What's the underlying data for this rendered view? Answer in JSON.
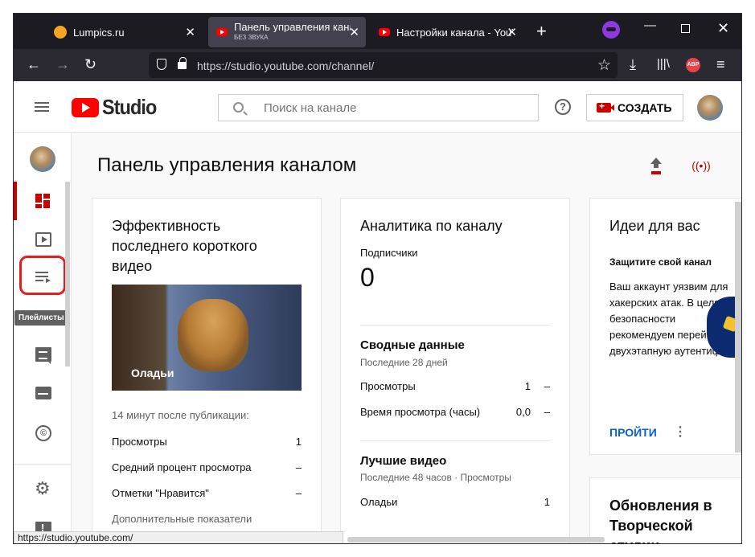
{
  "browser": {
    "tabs": [
      {
        "title": "Lumpics.ru"
      },
      {
        "title": "Панель управления канало",
        "subtitle": "БЕЗ ЗВУКА"
      },
      {
        "title": "Настройки канала - YouTu"
      }
    ],
    "close_glyph": "✕",
    "new_tab_glyph": "+",
    "url": "https://studio.youtube.com/channel/",
    "abp_badge": "ABP",
    "status_url": "https://studio.youtube.com/"
  },
  "header": {
    "wordmark": "Studio",
    "search_placeholder": "Поиск на канале",
    "help_glyph": "?",
    "create_label": "СОЗДАТЬ"
  },
  "sidebar": {
    "tooltip": "Плейлисты",
    "copyright_glyph": "©",
    "settings_glyph": "⚙"
  },
  "page": {
    "title": "Панель управления каналом",
    "live_glyph": "((•))"
  },
  "video_card": {
    "title": "Эффективность последнего короткого видео",
    "thumbnail_caption": "Оладьи",
    "since": "14 минут после публикации:",
    "rows": [
      {
        "label": "Просмотры",
        "value": "1"
      },
      {
        "label": "Средний процент просмотра",
        "value": "–"
      },
      {
        "label": "Отметки \"Нравится\"",
        "value": "–"
      }
    ],
    "more": "Дополнительные показатели"
  },
  "analytics_card": {
    "title": "Аналитика по каналу",
    "subscribers_label": "Подписчики",
    "subscribers_value": "0",
    "summary_title": "Сводные данные",
    "summary_period": "Последние 28 дней",
    "summary_rows": [
      {
        "label": "Просмотры",
        "value": "1",
        "trend": "–"
      },
      {
        "label": "Время просмотра (часы)",
        "value": "0,0",
        "trend": "–"
      }
    ],
    "top_title": "Лучшие видео",
    "top_period": "Последние 48 часов · Просмотры",
    "top_rows": [
      {
        "label": "Оладьи",
        "value": "1"
      }
    ]
  },
  "ideas_card": {
    "title": "Идеи для вас",
    "subtitle": "Защитите свой канал",
    "text": "Ваш аккаунт уязвим для хакерских атак. В целях безопасности рекомендуем перейти на двухэтапную аутентифика",
    "action": "ПРОЙТИ",
    "more_glyph": "⋮"
  },
  "updates_card": {
    "title": "Обновления в Творческой студии"
  },
  "colors": {
    "brand_red": "#ff0000",
    "accent_blue": "#065fd4",
    "highlight": "#e02020",
    "browser_dark": "#1c1b22"
  }
}
